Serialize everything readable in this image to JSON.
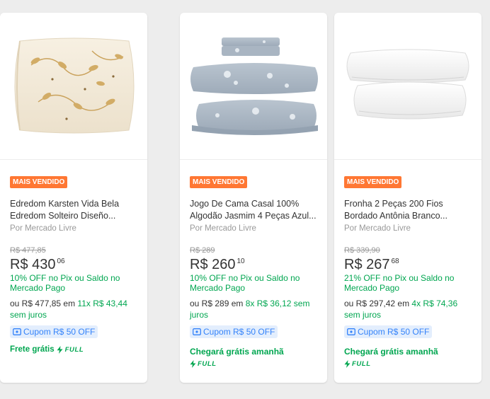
{
  "products": [
    {
      "badge": "MAIS VENDIDO",
      "title": "Jogo De Cama Casal 100% Algodão Jasmim 4 Peças Azul...",
      "seller": "Por Mercado Livre",
      "old_price": "R$ 289",
      "price": "R$ 260",
      "cents": "10",
      "discount": "10% OFF no Pix ou Saldo no Mercado Pago",
      "install_prefix": "ou R$ 289 em ",
      "install_highlight": "8x R$ 36,12 sem juros",
      "coupon": "Cupom R$ 50 OFF",
      "shipping": "Chegará grátis amanhã",
      "full": "FULL",
      "image": "gray-floral-bedsheet-set"
    },
    {
      "badge": "MAIS VENDIDO",
      "title": "Fronha 2 Peças 200 Fios Bordado Antônia Branco...",
      "seller": "Por Mercado Livre",
      "old_price": "R$ 339,90",
      "price": "R$ 267",
      "cents": "68",
      "discount": "21% OFF no Pix ou Saldo no Mercado Pago",
      "install_prefix": "ou R$ 297,42 em ",
      "install_highlight": "4x R$ 74,36",
      "install_suffix": "sem juros",
      "coupon": "Cupom R$ 50 OFF",
      "shipping": "Chegará grátis amanhã",
      "full": "FULL",
      "image": "white-pillowcases"
    },
    {
      "badge": "MAIS VENDIDO",
      "title": "Edredom Karsten Vida Bela Edredom Solteiro Diseño...",
      "seller": "Por Mercado Livre",
      "old_price": "R$ 477,85",
      "price": "R$ 430",
      "cents": "06",
      "discount": "10% OFF no Pix ou Saldo no Mercado Pago",
      "install_prefix": "ou R$ 477,85 em ",
      "install_highlight": "11x R$ 43,44",
      "install_suffix": "sem juros",
      "coupon": "Cupom R$ 50 OFF",
      "shipping": "Frete grátis",
      "full": "FULL",
      "image": "beige-floral-comforter"
    }
  ],
  "colors": {
    "accent_green": "#00a650",
    "badge_orange": "#ff7733",
    "coupon_blue": "#3483fa",
    "coupon_bg": "#e3eefd"
  }
}
